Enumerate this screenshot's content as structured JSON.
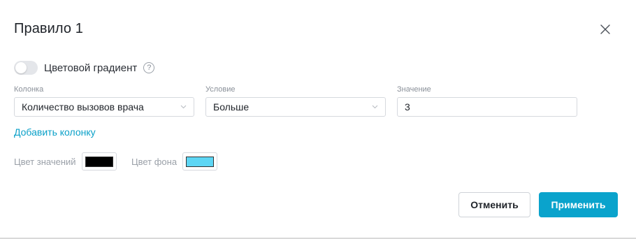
{
  "dialog": {
    "title": "Правило 1"
  },
  "gradient": {
    "label": "Цветовой градиент",
    "enabled": false,
    "help_icon_text": "?"
  },
  "fields": {
    "column": {
      "label": "Колонка",
      "value": "Количество вызовов врача"
    },
    "condition": {
      "label": "Условие",
      "value": "Больше"
    },
    "value": {
      "label": "Значение",
      "value": "3"
    }
  },
  "add_column_label": "Добавить колонку",
  "colors": {
    "value_color_label": "Цвет значений",
    "value_color": "#000000",
    "background_color_label": "Цвет фона",
    "background_color": "#5dd6f4"
  },
  "buttons": {
    "cancel": "Отменить",
    "apply": "Применить"
  },
  "theme": {
    "accent": "#0aa3cc",
    "link": "#0aa0c8"
  }
}
